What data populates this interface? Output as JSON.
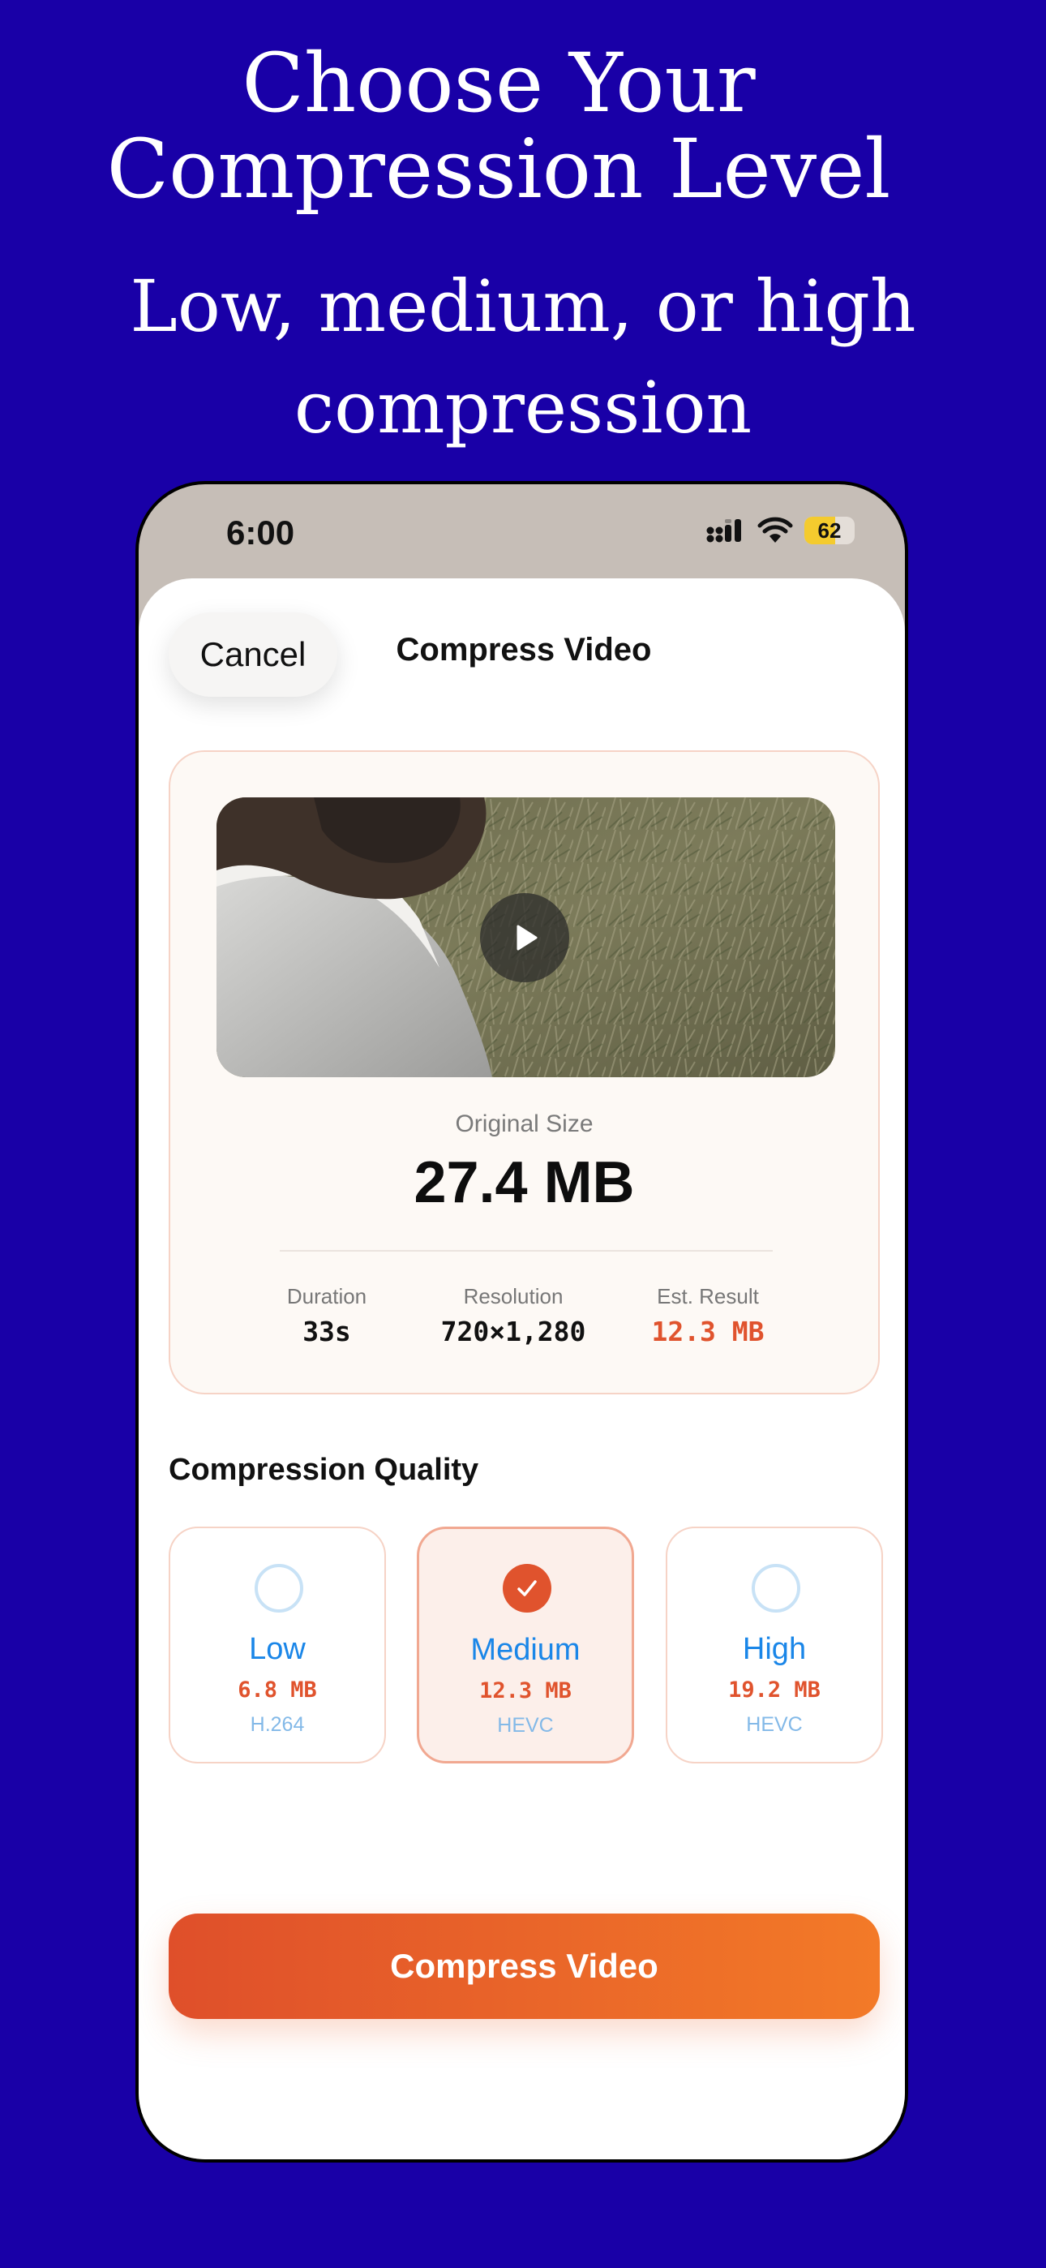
{
  "promo": {
    "title_line1": "Choose Your",
    "title_line2": "Compression Level",
    "subtitle_line1": "Low, medium, or high",
    "subtitle_line2": "compression"
  },
  "status_bar": {
    "time": "6:00",
    "battery": "62",
    "battery_level": 0.62
  },
  "sheet": {
    "cancel_label": "Cancel",
    "title": "Compress Video"
  },
  "video_info": {
    "original_label": "Original Size",
    "original_value": "27.4 MB",
    "stats": [
      {
        "label": "Duration",
        "value": "33s"
      },
      {
        "label": "Resolution",
        "value": "720×1,280"
      },
      {
        "label": "Est. Result",
        "value": "12.3 MB"
      }
    ]
  },
  "quality": {
    "heading": "Compression Quality",
    "options": [
      {
        "name": "Low",
        "size": "6.8 MB",
        "codec": "H.264",
        "selected": false
      },
      {
        "name": "Medium",
        "size": "12.3 MB",
        "codec": "HEVC",
        "selected": true
      },
      {
        "name": "High",
        "size": "19.2 MB",
        "codec": "HEVC",
        "selected": false
      }
    ]
  },
  "action": {
    "compress_label": "Compress Video"
  },
  "colors": {
    "background": "#1900A7",
    "accent": "#E0532D",
    "link_blue": "#1A86E8"
  },
  "icons": [
    "signal-icon",
    "wifi-icon",
    "battery-icon",
    "play-icon",
    "checkmark-icon"
  ]
}
